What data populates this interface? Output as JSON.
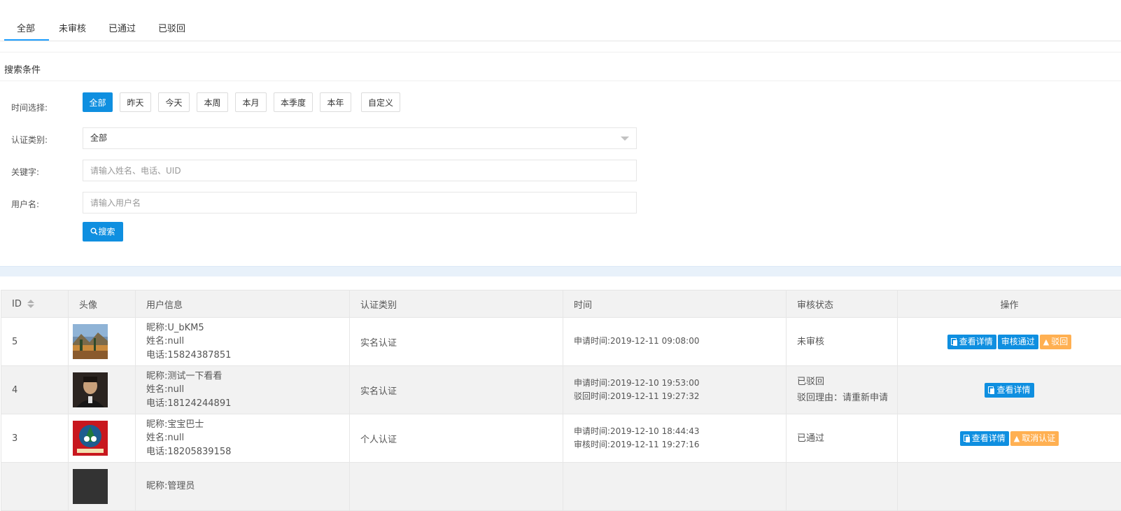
{
  "tabs": [
    "全部",
    "未审核",
    "已通过",
    "已驳回"
  ],
  "search_panel": {
    "title": "搜索条件",
    "time_label": "时间选择:",
    "time_options": [
      "全部",
      "昨天",
      "今天",
      "本周",
      "本月",
      "本季度",
      "本年",
      "自定义"
    ],
    "selected_time": "全部",
    "category_label": "认证类别:",
    "category_value": "全部",
    "keyword_label": "关键字:",
    "keyword_placeholder": "请输入姓名、电话、UID",
    "username_label": "用户名:",
    "username_placeholder": "请输入用户名",
    "search_button": "搜索"
  },
  "table": {
    "headers": [
      "ID",
      "头像",
      "用户信息",
      "认证类别",
      "时间",
      "审核状态",
      "操作"
    ],
    "rows": [
      {
        "id": "5",
        "avatar": "landscape-photo",
        "nickname": "昵称:U_bKM5",
        "name": "姓名:null",
        "phone": "电话:15824387851",
        "category": "实名认证",
        "time1": "申请时间:2019-12-11 09:08:00",
        "time2": "",
        "status": "未审核",
        "reason": "",
        "actions": [
          {
            "label": "查看详情",
            "style": "blue",
            "icon": "doc-icon"
          },
          {
            "label": "审核通过",
            "style": "blue",
            "icon": ""
          },
          {
            "label": "驳回",
            "style": "orange",
            "icon": "warning-icon"
          }
        ]
      },
      {
        "id": "4",
        "avatar": "portrait-photo",
        "nickname": "昵称:测试一下看看",
        "name": "姓名:null",
        "phone": "电话:18124244891",
        "category": "实名认证",
        "time1": "申请时间:2019-12-10 19:53:00",
        "time2": "驳回时间:2019-12-11 19:27:32",
        "status": "已驳回",
        "reason": "驳回理由：请重新申请",
        "actions": [
          {
            "label": "查看详情",
            "style": "blue",
            "icon": "doc-icon"
          }
        ]
      },
      {
        "id": "3",
        "avatar": "christmas-card",
        "nickname": "昵称:宝宝巴士",
        "name": "姓名:null",
        "phone": "电话:18205839158",
        "category": "个人认证",
        "time1": "申请时间:2019-12-10 18:44:43",
        "time2": "审核时间:2019-12-11 19:27:16",
        "status": "已通过",
        "reason": "",
        "actions": [
          {
            "label": "查看详情",
            "style": "blue",
            "icon": "doc-icon"
          },
          {
            "label": "取消认证",
            "style": "orange",
            "icon": "warning-icon"
          }
        ]
      },
      {
        "id": "",
        "avatar": "dark-photo",
        "nickname": "昵称:管理员",
        "name": "",
        "phone": "",
        "category": "",
        "time1": "",
        "time2": "",
        "status": "",
        "reason": "",
        "actions": []
      }
    ]
  },
  "colors": {
    "primary": "#0f8fe0",
    "warning": "#ffb052",
    "tab_active_underline": "#1e9fff",
    "header_bg": "#f2f2f2"
  }
}
